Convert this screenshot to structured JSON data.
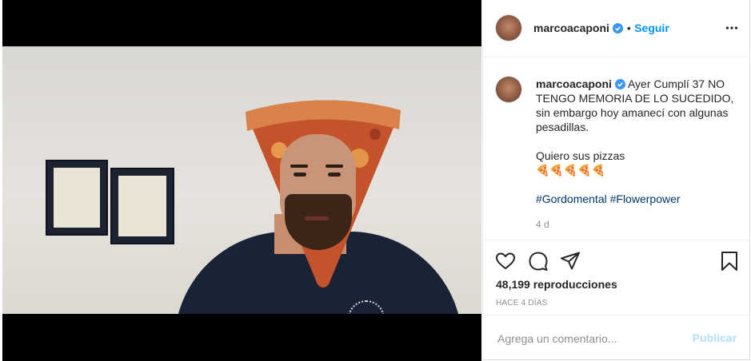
{
  "post": {
    "media": {
      "mute_icon": "speaker-muted-icon"
    },
    "header": {
      "username": "marcoacaponi",
      "separator": "•",
      "follow_label": "Seguir",
      "more_icon": "more-options-icon"
    },
    "caption": {
      "username": "marcoacaponi",
      "line1": "Ayer Cumplí 37 NO TENGO MEMORIA DE LO SUCEDIDO, sin embargo hoy amanecí con algunas pesadillas.",
      "line2": "Quiero sus pizzas",
      "emoji": "🍕🍕🍕🍕🍕",
      "hashtag1": "#Gordomental",
      "hashtag2": "#Flowerpower",
      "age": "4 d"
    },
    "actions": {
      "like_icon": "heart-icon",
      "comment_icon": "comment-icon",
      "share_icon": "share-icon",
      "save_icon": "bookmark-icon",
      "views": "48,199 reproducciones",
      "posted_ago": "HACE 4 DÍAS"
    },
    "comment": {
      "placeholder": "Agrega un comentario...",
      "publish_label": "Publicar"
    },
    "colors": {
      "accent": "#0095f6",
      "hashtag": "#00376b",
      "publish_disabled": "#b2dffc"
    }
  }
}
